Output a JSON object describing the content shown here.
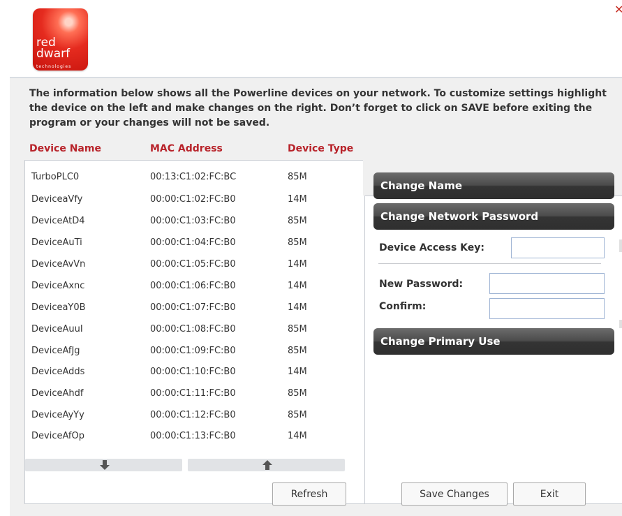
{
  "logo": {
    "line1": "red",
    "line2": "dwarf",
    "line3": "technologies"
  },
  "close_icon": "close-icon",
  "intro": "The information below shows all the Powerline devices on your network. To customize settings highlight the device on the left and make changes on the right. Don’t forget to click on SAVE before exiting the program or your changes will not be saved.",
  "columns": {
    "name": "Device Name",
    "mac": "MAC Address",
    "type": "Device Type"
  },
  "devices": [
    {
      "name": "TurboPLC0",
      "mac": "00:13:C1:02:FC:BC",
      "type": "85M"
    },
    {
      "name": "DeviceaVfy",
      "mac": "00:00:C1:02:FC:B0",
      "type": "14M"
    },
    {
      "name": "DeviceAtD4",
      "mac": "00:00:C1:03:FC:B0",
      "type": "85M"
    },
    {
      "name": "DeviceAuTi",
      "mac": "00:00:C1:04:FC:B0",
      "type": "85M"
    },
    {
      "name": "DeviceAvVn",
      "mac": "00:00:C1:05:FC:B0",
      "type": "14M"
    },
    {
      "name": "DeviceAxnc",
      "mac": "00:00:C1:06:FC:B0",
      "type": "14M"
    },
    {
      "name": "DeviceaY0B",
      "mac": "00:00:C1:07:FC:B0",
      "type": "14M"
    },
    {
      "name": "DeviceAuuI",
      "mac": "00:00:C1:08:FC:B0",
      "type": "85M"
    },
    {
      "name": "DeviceAfJg",
      "mac": "00:00:C1:09:FC:B0",
      "type": "85M"
    },
    {
      "name": "DeviceAdds",
      "mac": "00:00:C1:10:FC:B0",
      "type": "14M"
    },
    {
      "name": "DeviceAhdf",
      "mac": "00:00:C1:11:FC:B0",
      "type": "85M"
    },
    {
      "name": "DeviceAyYy",
      "mac": "00:00:C1:12:FC:B0",
      "type": "85M"
    },
    {
      "name": "DeviceAfOp",
      "mac": "00:00:C1:13:FC:B0",
      "type": "14M"
    }
  ],
  "selected_device": "TurboPLC0",
  "scroll": {
    "down_icon": "arrow-down-icon",
    "up_icon": "arrow-up-icon"
  },
  "buttons": {
    "refresh": "Refresh",
    "save": "Save Changes",
    "exit": "Exit"
  },
  "panel": {
    "change_name": "Change Name",
    "change_password": "Change Network Password",
    "access_key_label": "Device Access Key:",
    "access_key_value": "",
    "new_password_label": "New Password:",
    "new_password_value": "",
    "confirm_label": "Confirm:",
    "confirm_value": "",
    "change_primary_use": "Change Primary Use"
  },
  "colors": {
    "accent_red": "#b8232a",
    "dark_button": "#3a3a3a",
    "input_border": "#9fb4d4"
  }
}
